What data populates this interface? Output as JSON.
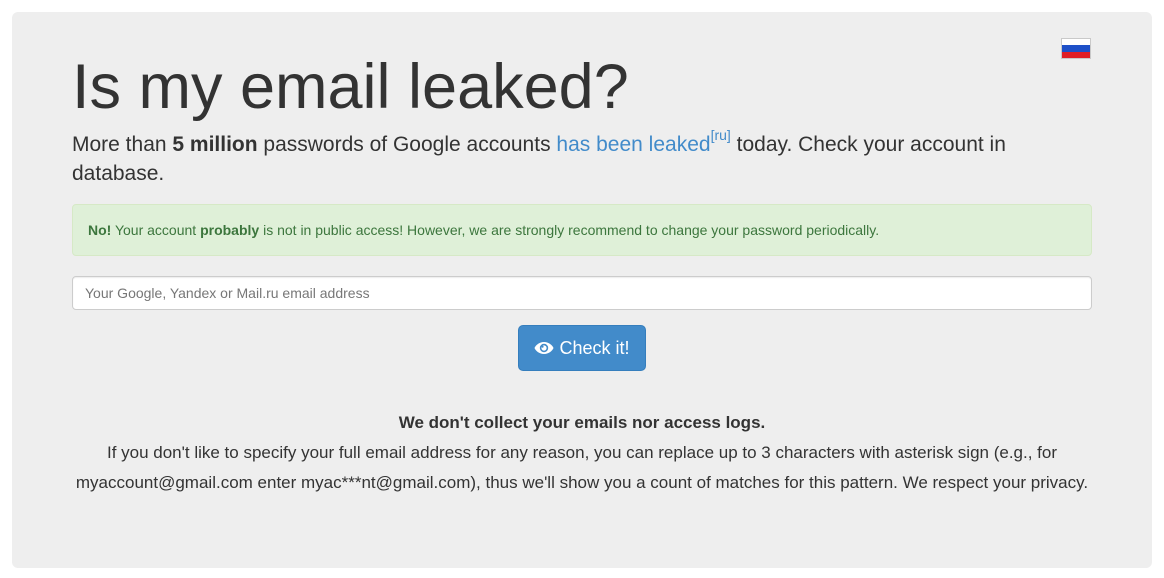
{
  "language_switch": {
    "icon": "russian-flag-icon",
    "colors": [
      "#ffffff",
      "#1e50c8",
      "#e01e26"
    ]
  },
  "header": {
    "title": "Is my email leaked?"
  },
  "lead": {
    "part1": "More than ",
    "highlight": "5 million",
    "part2": " passwords of Google accounts ",
    "link_text": "has been leaked",
    "link_sup": "[ru]",
    "part3": " today. Check your account in database."
  },
  "alert": {
    "prefix": "No!",
    "part1": " Your account ",
    "emphasis": "probably",
    "part2": " is not in public access! However, we are strongly recommend to change your password periodically.",
    "status_color": "#3c763d"
  },
  "search": {
    "value": "",
    "placeholder": "Your Google, Yandex or Mail.ru email address"
  },
  "check_button": {
    "icon": "eye-icon",
    "label": "Check it!",
    "color": "#428bca"
  },
  "privacy": {
    "headline": "We don't collect your emails nor access logs.",
    "body": "If you don't like to specify your full email address for any reason, you can replace up to 3 characters with asterisk sign (e.g., for myaccount@gmail.com enter myac***nt@gmail.com), thus we'll show you a count of matches for this pattern. We respect your privacy."
  }
}
